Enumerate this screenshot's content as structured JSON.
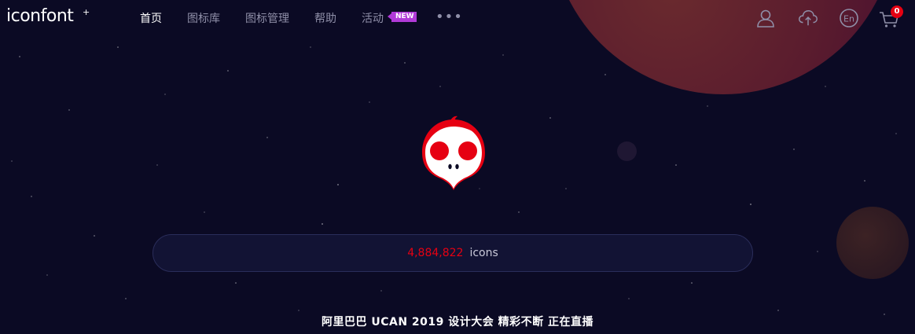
{
  "brand": {
    "logo_text": "iconfont",
    "logo_mark": "+"
  },
  "nav": {
    "items": [
      {
        "label": "首页",
        "active": true
      },
      {
        "label": "图标库",
        "active": false
      },
      {
        "label": "图标管理",
        "active": false
      },
      {
        "label": "帮助",
        "active": false
      },
      {
        "label": "活动",
        "active": false
      }
    ],
    "new_badge": "NEW",
    "more_label": "•••"
  },
  "header_actions": {
    "user_icon": "user-icon",
    "upload_icon": "cloud-upload-icon",
    "language_label": "En",
    "cart_icon": "cart-icon",
    "cart_count": "0"
  },
  "hero": {
    "mascot_icon": "skull-mascot-icon",
    "icon_count": "4,884,822",
    "icon_unit": "icons"
  },
  "banner": {
    "text": "阿里巴巴 UCAN 2019 设计大会 精彩不断 正在直播"
  },
  "colors": {
    "background": "#0b0a24",
    "accent_red": "#e60012",
    "new_badge": "#b13ad8",
    "nav_inactive": "#8f8fa8"
  }
}
